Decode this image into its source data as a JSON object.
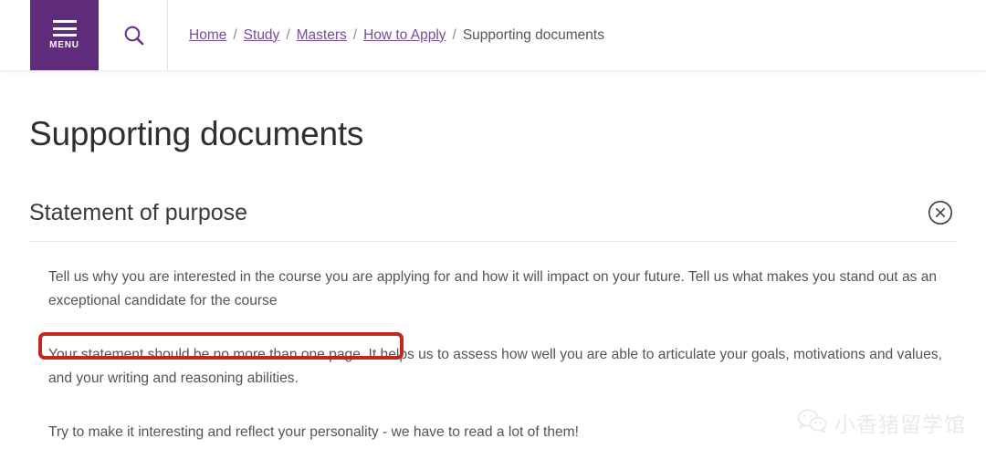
{
  "header": {
    "menu_label": "MENU",
    "menu_icon": "hamburger-icon",
    "search_icon": "search-icon",
    "brand_color": "#5F2B7B",
    "breadcrumb": {
      "items": [
        {
          "label": "Home",
          "link": true
        },
        {
          "label": "Study",
          "link": true
        },
        {
          "label": "Masters",
          "link": true
        },
        {
          "label": "How to Apply",
          "link": true
        },
        {
          "label": "Supporting documents",
          "link": false
        }
      ],
      "separator": "/",
      "link_color": "#7A4A9C"
    }
  },
  "main": {
    "page_title": "Supporting documents",
    "accordion": {
      "title": "Statement of purpose",
      "toggle_icon": "close-circle-icon",
      "expanded": true,
      "paragraphs": {
        "p1": "Tell us why you are interested in the course you are applying for and how it will impact on your future. Tell us what makes you stand out as an exceptional candidate for the course",
        "p2": "Your statement should be no more than one page. It helps us to assess how well you are able to articulate your goals, motivations and values, and your writing and reasoning abilities.",
        "p3": "Try to make it interesting and reflect your personality - we have to read a lot of them!"
      }
    }
  },
  "annotation": {
    "type": "red-rectangle-highlight",
    "color": "#C0281C",
    "highlights_text": "Your statement should be no more than one page."
  },
  "watermark": {
    "icon": "wechat-icon",
    "text": "小香猪留学馆"
  }
}
